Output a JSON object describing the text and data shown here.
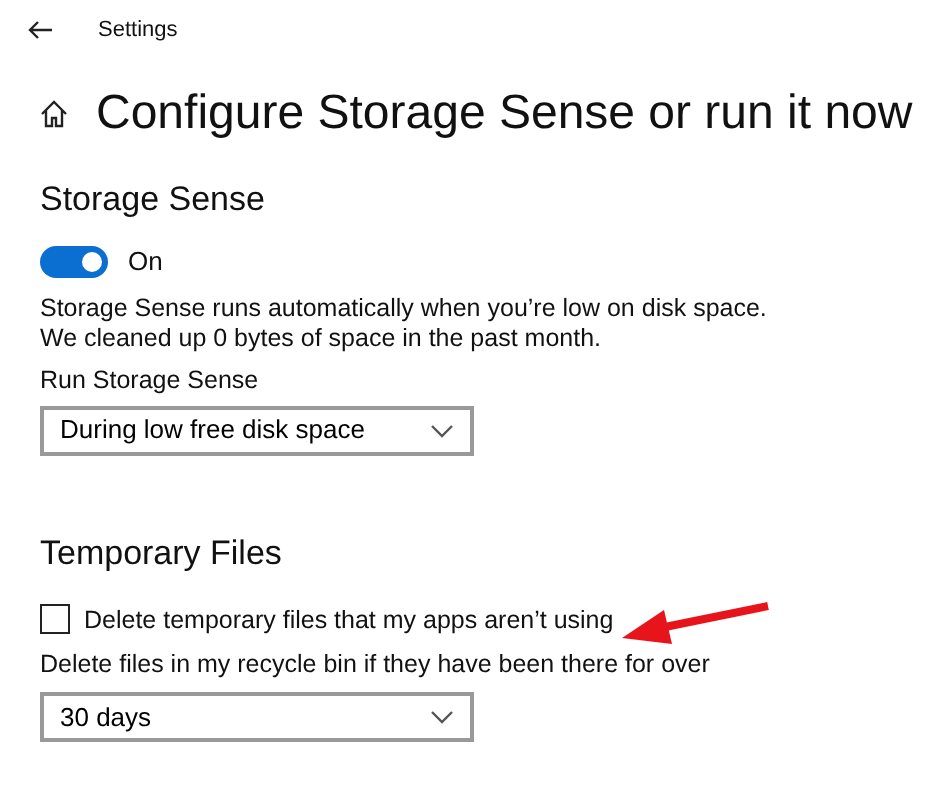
{
  "window": {
    "title": "Settings"
  },
  "page": {
    "title": "Configure Storage Sense or run it now"
  },
  "storage_sense": {
    "heading": "Storage Sense",
    "toggle": {
      "on": true,
      "label": "On"
    },
    "description": [
      "Storage Sense runs automatically when you’re low on disk space.",
      "We cleaned up 0 bytes of space in the past month."
    ],
    "run_label": "Run Storage Sense",
    "run_dropdown": {
      "value": "During low free disk space"
    }
  },
  "temporary_files": {
    "heading": "Temporary Files",
    "checkbox": {
      "label": "Delete temporary files that my apps aren’t using",
      "checked": false
    },
    "recycle_label": "Delete files in my recycle bin if they have been there for over",
    "recycle_dropdown": {
      "value": "30 days"
    }
  }
}
